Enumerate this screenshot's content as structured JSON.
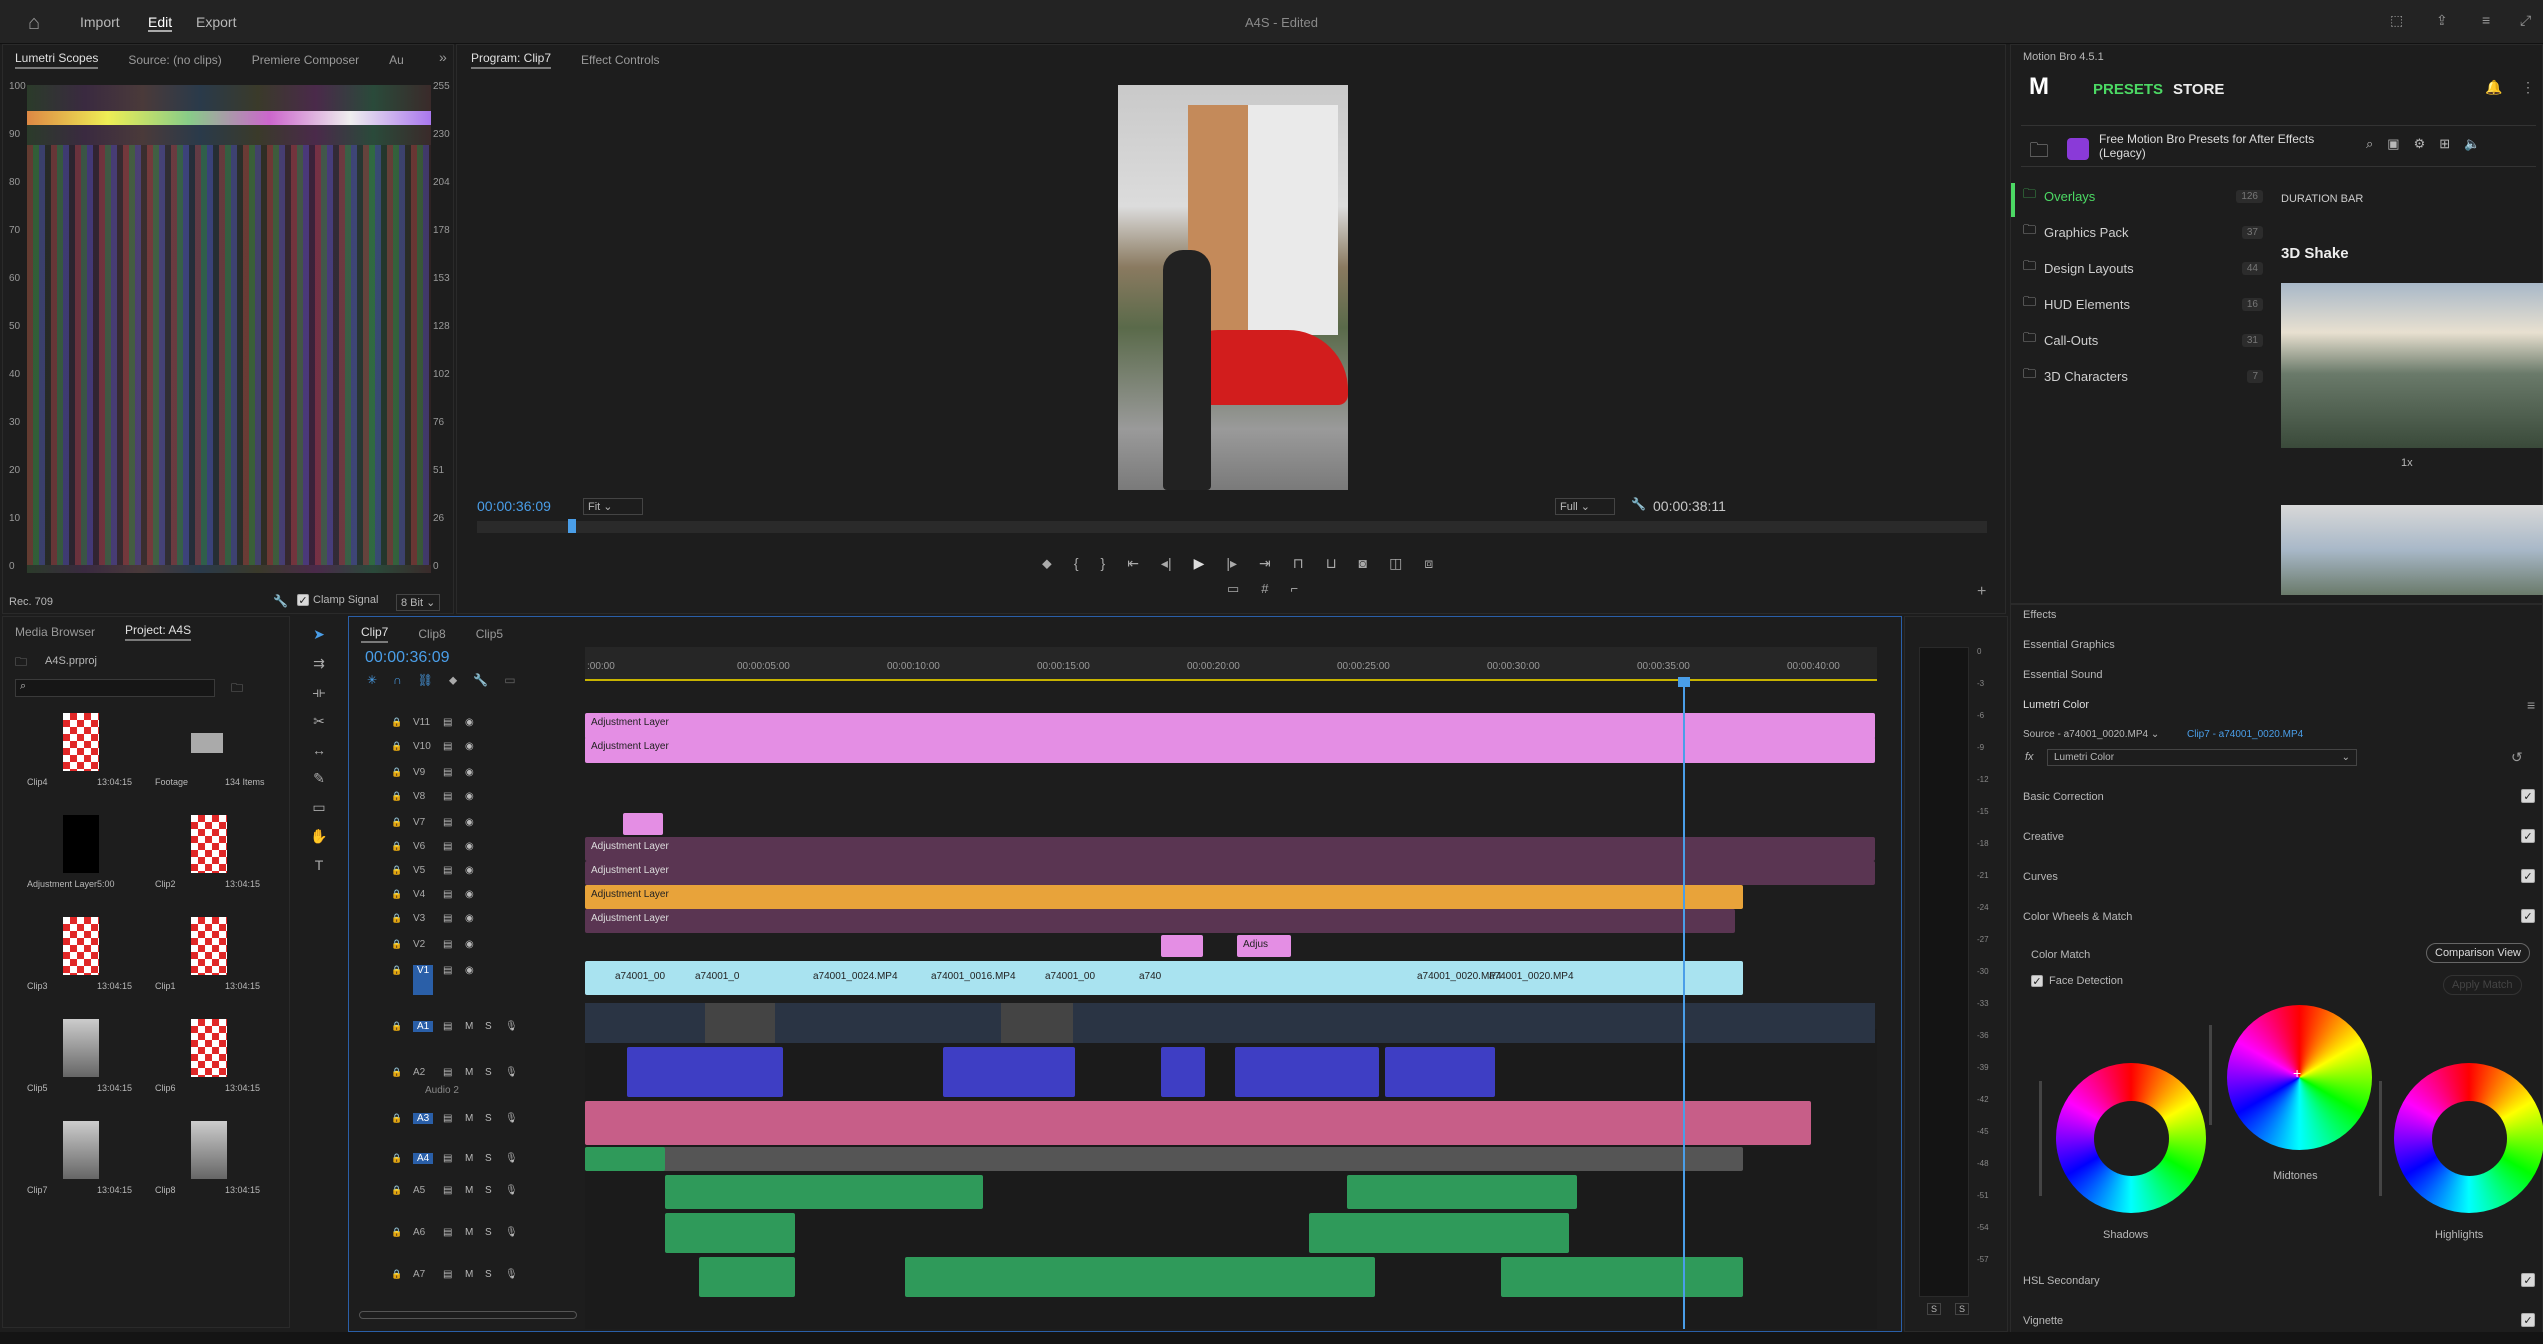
{
  "topbar": {
    "import": "Import",
    "edit": "Edit",
    "export": "Export",
    "title": "A4S - Edited"
  },
  "source_panel": {
    "tabs": [
      "Lumetri Scopes",
      "Source: (no clips)",
      "Premiere Composer",
      "Au"
    ],
    "bottom_left": "Rec. 709",
    "clamp": "Clamp Signal",
    "bit": "8 Bit",
    "left_scale": [
      "100",
      "90",
      "80",
      "70",
      "60",
      "50",
      "40",
      "30",
      "20",
      "10",
      "0"
    ],
    "right_scale": [
      "255",
      "230",
      "204",
      "178",
      "153",
      "128",
      "102",
      "76",
      "51",
      "26",
      "0"
    ]
  },
  "program": {
    "tab": "Program: Clip7",
    "tab2": "Effect Controls",
    "timecode": "00:00:36:09",
    "fit": "Fit",
    "full": "Full",
    "duration": "00:00:38:11",
    "playhead_fraction": 0.06
  },
  "motionbro": {
    "title": "Motion Bro 4.5.1",
    "presets": "PRESETS",
    "store": "STORE",
    "pack": "Free Motion Bro Presets for After Effects (Legacy)",
    "items": [
      {
        "label": "Overlays",
        "count": "126"
      },
      {
        "label": "Graphics Pack",
        "count": "37"
      },
      {
        "label": "Design Layouts",
        "count": "44"
      },
      {
        "label": "HUD Elements",
        "count": "16"
      },
      {
        "label": "Call-Outs",
        "count": "31"
      },
      {
        "label": "3D Characters",
        "count": "7"
      }
    ],
    "section": "DURATION BAR",
    "preset": "3D Shake",
    "preset_label": "1x"
  },
  "right_panels": {
    "effects": "Effects",
    "graphics": "Essential Graphics",
    "sound": "Essential Sound",
    "lumetri": "Lumetri Color",
    "source": "Source - a74001_0020.MP4",
    "clip": "Clip7 - a74001_0020.MP4",
    "fx": "Lumetri Color",
    "sections": [
      "Basic Correction",
      "Creative",
      "Curves",
      "Color Wheels & Match"
    ],
    "color_match": "Color Match",
    "comparison": "Comparison View",
    "face": "Face Detection",
    "apply": "Apply Match",
    "wheels": [
      "Shadows",
      "Midtones",
      "Highlights"
    ],
    "hsl": "HSL Secondary",
    "vignette": "Vignette"
  },
  "project": {
    "tabs": [
      "Media Browser",
      "Project: A4S"
    ],
    "file": "A4S.prproj",
    "items": [
      {
        "name": "Clip4",
        "dur": "13:04:15"
      },
      {
        "name": "Footage",
        "dur": "134 Items"
      },
      {
        "name": "Adjustment Layer",
        "dur": "5:00"
      },
      {
        "name": "Clip2",
        "dur": "13:04:15"
      },
      {
        "name": "Clip3",
        "dur": "13:04:15"
      },
      {
        "name": "Clip1",
        "dur": "13:04:15"
      },
      {
        "name": "Clip5",
        "dur": "13:04:15"
      },
      {
        "name": "Clip6",
        "dur": "13:04:15"
      },
      {
        "name": "Clip7",
        "dur": "13:04:15"
      },
      {
        "name": "Clip8",
        "dur": "13:04:15"
      }
    ]
  },
  "timeline": {
    "tabs": [
      "Clip7",
      "Clip8",
      "Clip5"
    ],
    "timecode": "00:00:36:09",
    "ruler": [
      ":00:00",
      "00:00:05:00",
      "00:00:10:00",
      "00:00:15:00",
      "00:00:20:00",
      "00:00:25:00",
      "00:00:30:00",
      "00:00:35:00",
      "00:00:40:00"
    ],
    "video_tracks": [
      "V11",
      "V10",
      "V9",
      "V8",
      "V7",
      "V6",
      "V5",
      "V4",
      "V3",
      "V2",
      "V1"
    ],
    "audio_tracks": [
      "A1",
      "A2",
      "A3",
      "A4",
      "A5",
      "A6",
      "A7"
    ],
    "audio2": "Audio 2",
    "adj": "Adjustment Layer",
    "adju": "Adjus",
    "v1clips": [
      "a74001_00",
      "a74001_0",
      "a74001_0024.MP4",
      "a74001_0016.MP4",
      "a74001_00",
      "a740",
      "a74001_0020.MP4",
      "a74001_0020.MP4"
    ],
    "meter": [
      "0",
      "-3",
      "-6",
      "-9",
      "-12",
      "-15",
      "-18",
      "-21",
      "-24",
      "-27",
      "-30",
      "-33",
      "-36",
      "-39",
      "-42",
      "-45",
      "-48",
      "-51",
      "-54",
      "-57"
    ]
  }
}
